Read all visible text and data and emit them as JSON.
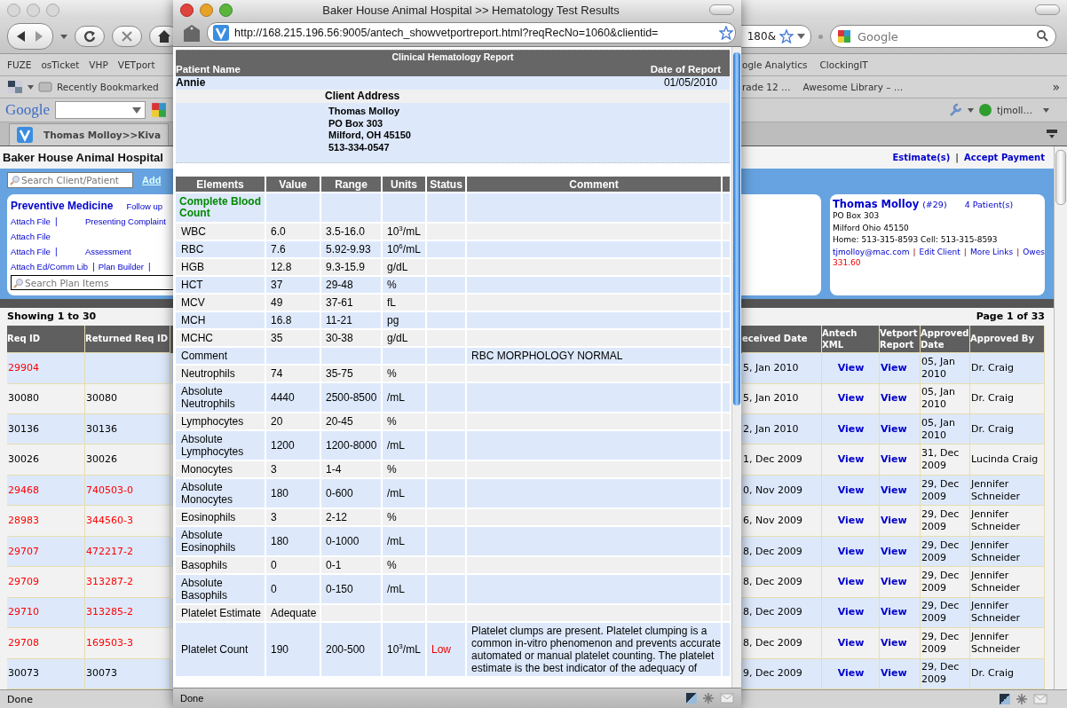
{
  "browser": {
    "nav": {
      "url_fragment": "180&",
      "search_placeholder": "Google"
    },
    "bookmarks": [
      "FUZE",
      "osTicket",
      "VHP",
      "VETport"
    ],
    "bookmarks_right": [
      "ogle Analytics",
      "ClockingIT"
    ],
    "bookmarks_2": [
      "Recently Bookmarked"
    ],
    "bookmarks_2_right": [
      "rade 12 …",
      "Awesome Library – …"
    ],
    "bookmarks_2_overflow": "»",
    "google_bar": {
      "logo": "Google",
      "user": "tjmoll…"
    },
    "tab": {
      "title": "Thomas Molloy>>Kiva"
    },
    "status": "Done"
  },
  "page": {
    "title": "Baker House Animal Hospital",
    "header_links": [
      {
        "label": "Estimate(s)",
        "separator": "|"
      },
      {
        "label": "Accept Payment"
      }
    ],
    "search_placeholder": "Search Client/Patient",
    "add_link": "Add",
    "plan_panel": {
      "title": "Preventive Medicine",
      "follow_up": "Follow up",
      "rows": [
        [
          {
            "label": "Attach File",
            "separator": "|"
          },
          {
            "label": "Presenting Complaint"
          }
        ],
        [
          {
            "label": "Attach File"
          }
        ],
        [
          {
            "label": "Attach File",
            "separator": "|"
          },
          {
            "label": "Assessment"
          }
        ],
        [
          {
            "label": "Attach Ed/Comm Lib",
            "separator": "|"
          },
          {
            "label": "Plan Builder",
            "separator": "|"
          }
        ]
      ],
      "search_placeholder": "Search Plan Items"
    },
    "client_card": {
      "name": "Thomas Molloy",
      "number": "(#29)",
      "patients": "4 Patient(s)",
      "lines": [
        "PO Box 303",
        "Milford Ohio 45150",
        "Home: 513-315-8593 Cell: 513-315-8593"
      ],
      "links": [
        {
          "label": "tjmolloy@mac.com",
          "separator": "|"
        },
        {
          "label": "Edit Client",
          "separator": "|"
        },
        {
          "label": "More Links",
          "separator": "|"
        },
        {
          "label": "Owes"
        }
      ],
      "owes_amount": "331.60"
    },
    "table": {
      "showing": "Showing 1 to 30",
      "pager": "Page 1 of 33",
      "columns": [
        "Req ID",
        "Returned Req ID",
        "eceived Date",
        "Antech XML",
        "Vetport Report",
        "Approved Date",
        "Approved By"
      ],
      "rows": [
        {
          "req_id": "29904",
          "returned_id": "",
          "received": "5, Jan 2010",
          "xml": "View",
          "report": "View",
          "approved_date": "05, Jan 2010",
          "approved_by": "Dr. Craig",
          "color": "#ff0000"
        },
        {
          "req_id": "30080",
          "returned_id": "30080",
          "received": "5, Jan 2010",
          "xml": "View",
          "report": "View",
          "approved_date": "05, Jan 2010",
          "approved_by": "Dr. Craig",
          "color": "#000000"
        },
        {
          "req_id": "30136",
          "returned_id": "30136",
          "received": "2, Jan 2010",
          "xml": "View",
          "report": "View",
          "approved_date": "05, Jan 2010",
          "approved_by": "Dr. Craig",
          "color": "#000000"
        },
        {
          "req_id": "30026",
          "returned_id": "30026",
          "received": "1, Dec 2009",
          "xml": "View",
          "report": "View",
          "approved_date": "31, Dec 2009",
          "approved_by": "Lucinda Craig",
          "color": "#000000"
        },
        {
          "req_id": "29468",
          "returned_id": "740503-0",
          "received": "0, Nov 2009",
          "xml": "View",
          "report": "View",
          "approved_date": "29, Dec 2009",
          "approved_by": "Jennifer Schneider",
          "color": "#ff0000"
        },
        {
          "req_id": "28983",
          "returned_id": "344560-3",
          "received": "6, Nov 2009",
          "xml": "View",
          "report": "View",
          "approved_date": "29, Dec 2009",
          "approved_by": "Jennifer Schneider",
          "color": "#ff0000"
        },
        {
          "req_id": "29707",
          "returned_id": "472217-2",
          "received": "8, Dec 2009",
          "xml": "View",
          "report": "View",
          "approved_date": "29, Dec 2009",
          "approved_by": "Jennifer Schneider",
          "color": "#ff0000"
        },
        {
          "req_id": "29709",
          "returned_id": "313287-2",
          "received": "8, Dec 2009",
          "xml": "View",
          "report": "View",
          "approved_date": "29, Dec 2009",
          "approved_by": "Jennifer Schneider",
          "color": "#ff0000"
        },
        {
          "req_id": "29710",
          "returned_id": "313285-2",
          "received": "8, Dec 2009",
          "xml": "View",
          "report": "View",
          "approved_date": "29, Dec 2009",
          "approved_by": "Jennifer Schneider",
          "color": "#ff0000"
        },
        {
          "req_id": "29708",
          "returned_id": "169503-3",
          "received": "8, Dec 2009",
          "xml": "View",
          "report": "View",
          "approved_date": "29, Dec 2009",
          "approved_by": "Jennifer Schneider",
          "color": "#ff0000"
        },
        {
          "req_id": "30073",
          "returned_id": "30073",
          "received": "9, Dec 2009",
          "xml": "View",
          "report": "View",
          "approved_date": "29, Dec 2009",
          "approved_by": "Dr. Craig",
          "color": "#000000"
        }
      ]
    }
  },
  "popup": {
    "title": "Baker House Animal Hospital >> Hematology Test Results",
    "url": "http://168.215.196.56:9005/antech_showvetportreport.html?reqRecNo=1060&clientid=",
    "report": {
      "title": "Clinical Hematology Report",
      "patient_label": "Patient Name",
      "date_label": "Date of Report",
      "patient": "Annie",
      "date": "01/05/2010",
      "address_label": "Client Address",
      "address": [
        "Thomas Molloy",
        "PO Box 303",
        "Milford, OH 45150",
        "513-334-0547"
      ]
    },
    "columns": [
      "Elements",
      "Value",
      "Range",
      "Units",
      "Status",
      "Comment"
    ],
    "rows": [
      {
        "kind": "section",
        "element": "Complete Blood Count"
      },
      {
        "kind": "result",
        "element": "WBC",
        "value": "6.0",
        "range": "3.5-16.0",
        "units": "10$^{3}$/mL"
      },
      {
        "kind": "result",
        "element": "RBC",
        "value": "7.6",
        "range": "5.92-9.93",
        "units": "10$^{6}$/mL"
      },
      {
        "kind": "result",
        "element": "HGB",
        "value": "12.8",
        "range": "9.3-15.9",
        "units": "g/dL"
      },
      {
        "kind": "result",
        "element": "HCT",
        "value": "37",
        "range": "29-48",
        "units": "%"
      },
      {
        "kind": "result",
        "element": "MCV",
        "value": "49",
        "range": "37-61",
        "units": "fL"
      },
      {
        "kind": "result",
        "element": "MCH",
        "value": "16.8",
        "range": "11-21",
        "units": "pg"
      },
      {
        "kind": "result",
        "element": "MCHC",
        "value": "35",
        "range": "30-38",
        "units": "g/dL"
      },
      {
        "kind": "result",
        "element": "Comment",
        "comment": "RBC MORPHOLOGY NORMAL"
      },
      {
        "kind": "result",
        "element": "Neutrophils",
        "value": "74",
        "range": "35-75",
        "units": "%"
      },
      {
        "kind": "result",
        "element": "Absolute Neutrophils",
        "value": "4440",
        "range": "2500-8500",
        "units": "/mL"
      },
      {
        "kind": "result",
        "element": "Lymphocytes",
        "value": "20",
        "range": "20-45",
        "units": "%"
      },
      {
        "kind": "result",
        "element": "Absolute Lymphocytes",
        "value": "1200",
        "range": "1200-8000",
        "units": "/mL"
      },
      {
        "kind": "result",
        "element": "Monocytes",
        "value": "3",
        "range": "1-4",
        "units": "%"
      },
      {
        "kind": "result",
        "element": "Absolute Monocytes",
        "value": "180",
        "range": "0-600",
        "units": "/mL"
      },
      {
        "kind": "result",
        "element": "Eosinophils",
        "value": "3",
        "range": "2-12",
        "units": "%"
      },
      {
        "kind": "result",
        "element": "Absolute Eosinophils",
        "value": "180",
        "range": "0-1000",
        "units": "/mL"
      },
      {
        "kind": "result",
        "element": "Basophils",
        "value": "0",
        "range": "0-1",
        "units": "%"
      },
      {
        "kind": "result",
        "element": "Absolute Basophils",
        "value": "0",
        "range": "0-150",
        "units": "/mL"
      },
      {
        "kind": "result",
        "element": "Platelet Estimate",
        "value": "Adequate"
      },
      {
        "kind": "result",
        "element": "Platelet Count",
        "value": "190",
        "range": "200-500",
        "units": "10$^{3}$/mL",
        "status": "Low",
        "comment": "Platelet clumps are present. Platelet clumping is a common in-vitro phenomenon and prevents accurate automated or manual platelet counting. The platelet estimate is the best indicator of the adequacy of"
      }
    ],
    "status": "Done"
  }
}
